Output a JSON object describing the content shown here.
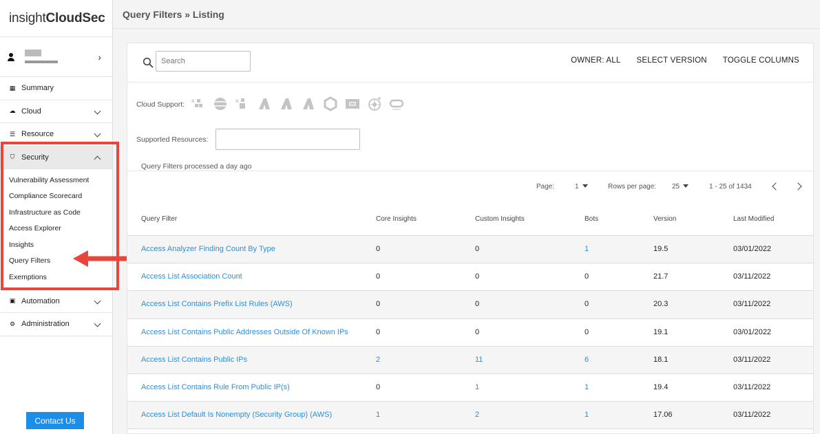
{
  "app": {
    "logo_light": "insight",
    "logo_bold": "CloudSec"
  },
  "sidebar": {
    "nav": [
      {
        "label": "Summary",
        "icon": "dashboard-icon"
      },
      {
        "label": "Cloud",
        "icon": "cloud-icon"
      },
      {
        "label": "Resource",
        "icon": "list-icon"
      },
      {
        "label": "Security",
        "icon": "shield-icon"
      },
      {
        "label": "Automation",
        "icon": "lock-icon"
      },
      {
        "label": "Administration",
        "icon": "gear-icon"
      }
    ],
    "security_sub": [
      "Vulnerability Assessment",
      "Compliance Scorecard",
      "Infrastructure as Code",
      "Access Explorer",
      "Insights",
      "Query Filters",
      "Exemptions"
    ],
    "contact_label": "Contact Us"
  },
  "header": {
    "breadcrumb": "Query Filters » Listing"
  },
  "toolbar": {
    "search_placeholder": "Search",
    "owner": "OWNER: ALL",
    "select_version": "SELECT VERSION",
    "toggle_columns": "TOGGLE COLUMNS"
  },
  "filters": {
    "cloud_support_label": "Cloud Support:",
    "supported_resources_label": "Supported Resources:",
    "processed_text": "Query Filters processed a day ago"
  },
  "pagination": {
    "page_label": "Page:",
    "page_value": "1",
    "rows_label": "Rows per page:",
    "rows_value": "25",
    "range": "1 - 25 of 1434"
  },
  "table": {
    "columns": [
      "Query Filter",
      "Core Insights",
      "Custom Insights",
      "Bots",
      "Version",
      "Last Modified"
    ],
    "rows": [
      [
        "Access Analyzer Finding Count By Type",
        "0",
        "0",
        "1",
        "19.5",
        "03/01/2022"
      ],
      [
        "Access List Association Count",
        "0",
        "0",
        "0",
        "21.7",
        "03/11/2022"
      ],
      [
        "Access List Contains Prefix List Rules (AWS)",
        "0",
        "0",
        "0",
        "20.3",
        "03/11/2022"
      ],
      [
        "Access List Contains Public Addresses Outside Of Known IPs",
        "0",
        "0",
        "0",
        "19.1",
        "03/01/2022"
      ],
      [
        "Access List Contains Public IPs",
        "2",
        "11",
        "6",
        "18.1",
        "03/11/2022"
      ],
      [
        "Access List Contains Rule From Public IP(s)",
        "0",
        "1",
        "1",
        "19.4",
        "03/11/2022"
      ],
      [
        "Access List Default Is Nonempty (Security Group) (AWS)",
        "1",
        "2",
        "1",
        "17.06",
        "03/11/2022"
      ]
    ]
  },
  "colors": {
    "link": "#2b8fd9",
    "accent": "#1a8ee8",
    "highlight": "#e8453c"
  }
}
